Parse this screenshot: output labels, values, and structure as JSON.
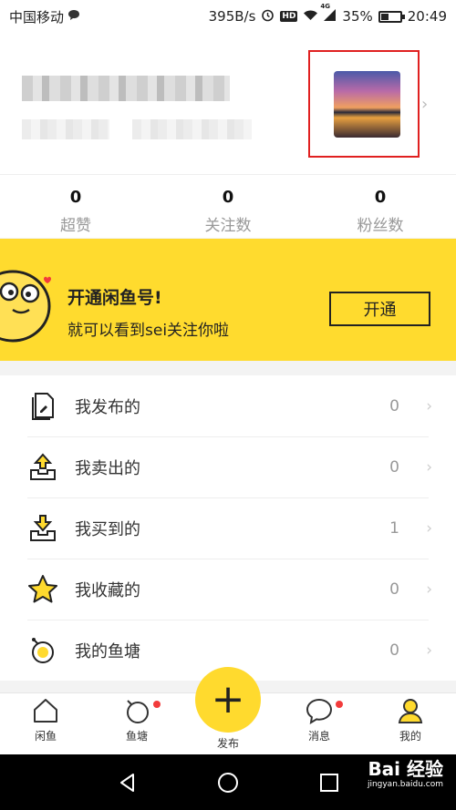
{
  "status_bar": {
    "carrier": "中国移动",
    "speed": "395B/s",
    "hd": "HD",
    "network": "4G",
    "battery": "35%",
    "time": "20:49"
  },
  "profile": {
    "chevron": "›"
  },
  "stats": [
    {
      "value": "0",
      "label": "超赞"
    },
    {
      "value": "0",
      "label": "关注数"
    },
    {
      "value": "0",
      "label": "粉丝数"
    }
  ],
  "banner": {
    "title": "开通闲鱼号!",
    "subtitle": "就可以看到sei关注你啦",
    "button": "开通"
  },
  "list": [
    {
      "label": "我发布的",
      "count": "0",
      "icon": "document-pen-icon"
    },
    {
      "label": "我卖出的",
      "count": "0",
      "icon": "tray-upload-icon"
    },
    {
      "label": "我买到的",
      "count": "1",
      "icon": "tray-download-icon"
    },
    {
      "label": "我收藏的",
      "count": "0",
      "icon": "star-icon"
    },
    {
      "label": "我的鱼塘",
      "count": "0",
      "icon": "fishpond-icon"
    }
  ],
  "list_chevron": "›",
  "tabs": [
    {
      "label": "闲鱼",
      "icon": "house-icon"
    },
    {
      "label": "鱼塘",
      "icon": "fishpond-icon",
      "badge": true
    },
    {
      "label": "发布",
      "icon": "plus-icon"
    },
    {
      "label": "消息",
      "icon": "chat-bubble-icon",
      "badge": true
    },
    {
      "label": "我的",
      "icon": "person-icon",
      "active": true
    }
  ],
  "publish_symbol": "+",
  "watermark": {
    "text": "Bai 经验",
    "sub": "jingyan.baidu.com"
  },
  "colors": {
    "accent": "#ffda2e",
    "badge": "#f23b3b",
    "highlight_frame": "#e02020"
  }
}
